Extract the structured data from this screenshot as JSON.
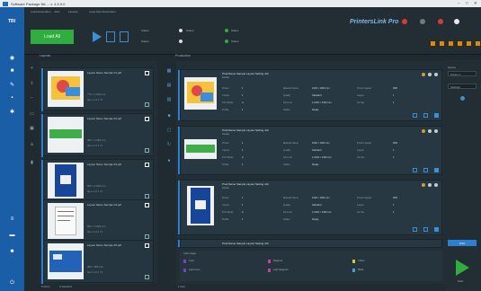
{
  "window": {
    "title": "Software Package file ... v. 4.5.9.0",
    "controls": [
      "–",
      "□",
      "✕"
    ]
  },
  "sidebar": {
    "logo": "TRI",
    "items": [
      {
        "icon": "globe-icon",
        "glyph": "◉"
      },
      {
        "icon": "layers-icon",
        "glyph": "■"
      },
      {
        "icon": "wrench-icon",
        "glyph": "✎"
      },
      {
        "icon": "document-icon",
        "glyph": "▪"
      },
      {
        "icon": "gear-icon",
        "glyph": "✱"
      },
      {
        "icon": "list-icon",
        "glyph": "≡"
      },
      {
        "icon": "file-icon",
        "glyph": "▬"
      },
      {
        "icon": "user-icon",
        "glyph": "☻"
      },
      {
        "icon": "power-icon",
        "glyph": "⏻"
      }
    ]
  },
  "topbar": {
    "labels": [
      "Load Automation",
      "Jobs",
      "Layouts",
      "Load Jobs Automation"
    ],
    "start_label": "Load All",
    "brand": "PrintersLink Pro",
    "status": [
      "Status",
      "Status",
      "Status",
      "Status",
      "Status"
    ],
    "accent": "#2fae3f"
  },
  "left_panel": {
    "title": "Layouts",
    "items": [
      {
        "name": "Layout Name Sample 01.pdf",
        "meta1": "770 × 1,500 mm",
        "meta2": "Item 1 of 1 / 5",
        "thumb": "color-photo"
      },
      {
        "name": "Layout Name Sample 02.pdf",
        "meta1": "480 × 1,250 mm",
        "meta2": "Item 1 of 1 / 5",
        "thumb": "green-banner"
      },
      {
        "name": "Layout Name Sample 03.pdf",
        "meta1": "500 × 1,500 mm",
        "meta2": "Item 1 of 1 / 5",
        "thumb": "blue-box"
      },
      {
        "name": "Layout Name Sample 04.pdf",
        "meta1": "500 × 1,500 mm",
        "meta2": "Item 1 of 1 / 5",
        "thumb": "text-doc"
      },
      {
        "name": "Layout Name Sample 05.pdf",
        "meta1": "480 × 850 mm",
        "meta2": "Item 1 of 1 / 5",
        "thumb": "blue-poster"
      }
    ],
    "footer": [
      "5 items",
      "0 selected"
    ]
  },
  "center_panel": {
    "title": "Production",
    "jobs": [
      {
        "name": "Prod.Name Sample Layout Setting Job",
        "sub": "Details",
        "rows": [
          [
            "Printer",
            "1",
            "Material Name",
            "1000 × 1000 mm",
            "Printer Speed",
            "99%"
          ],
          [
            "Copies",
            "1",
            "Quality",
            "Standard",
            "Layout",
            "1"
          ],
          [
            "Print Mode",
            "A",
            "Ink Limit",
            "1,1000 × 1000 mm",
            "Ink Set",
            "1"
          ],
          [
            "Profile",
            "1",
            "Status",
            "Ready",
            "",
            ""
          ]
        ]
      },
      {
        "name": "Prod.Name Sample Layout Setting Job",
        "sub": "Details",
        "rows": [
          [
            "Printer",
            "1",
            "Material Name",
            "1000 × 1000 mm",
            "Printer Speed",
            "99%"
          ],
          [
            "Copies",
            "1",
            "Quality",
            "Standard",
            "Layout",
            "1"
          ],
          [
            "Print Mode",
            "A",
            "Ink Limit",
            "1,1000 × 1000 mm",
            "Ink Set",
            "1"
          ],
          [
            "Profile",
            "1",
            "Status",
            "Ready",
            "",
            ""
          ]
        ]
      },
      {
        "name": "Prod.Name Sample Layout Setting Job",
        "sub": "Details",
        "rows": [
          [
            "Printer",
            "1",
            "Material Name",
            "1000 × 1000 mm",
            "Printer Speed",
            "99%"
          ],
          [
            "Copies",
            "1",
            "Quality",
            "Standard",
            "Layout",
            "1"
          ],
          [
            "Print Mode",
            "A",
            "Ink Limit",
            "1,1000 × 1000 mm",
            "Ink Set",
            "1"
          ],
          [
            "Profile",
            "1",
            "Status",
            "Ready",
            "",
            ""
          ]
        ]
      },
      {
        "name": "Prod.Name Sample Layout Setting Job",
        "sub": "Details",
        "rows": []
      }
    ],
    "legend_title": "Color usage",
    "legend": [
      {
        "label": "Cyan",
        "color": "#7b3fc4"
      },
      {
        "label": "Magenta",
        "color": "#c43f9f"
      },
      {
        "label": "Yellow",
        "color": "#d6c630"
      },
      {
        "label": "Black",
        "color": "#3fa7c4"
      },
      {
        "label": "Light Cyan",
        "color": "#7b3fc4"
      },
      {
        "label": "Light Magenta",
        "color": "#c43f9f"
      }
    ],
    "footer": "1 item"
  },
  "right_panel": {
    "labels": [
      "Queue",
      "Printer 1",
      "Settings"
    ],
    "button": "Print",
    "play_label": "Start"
  }
}
